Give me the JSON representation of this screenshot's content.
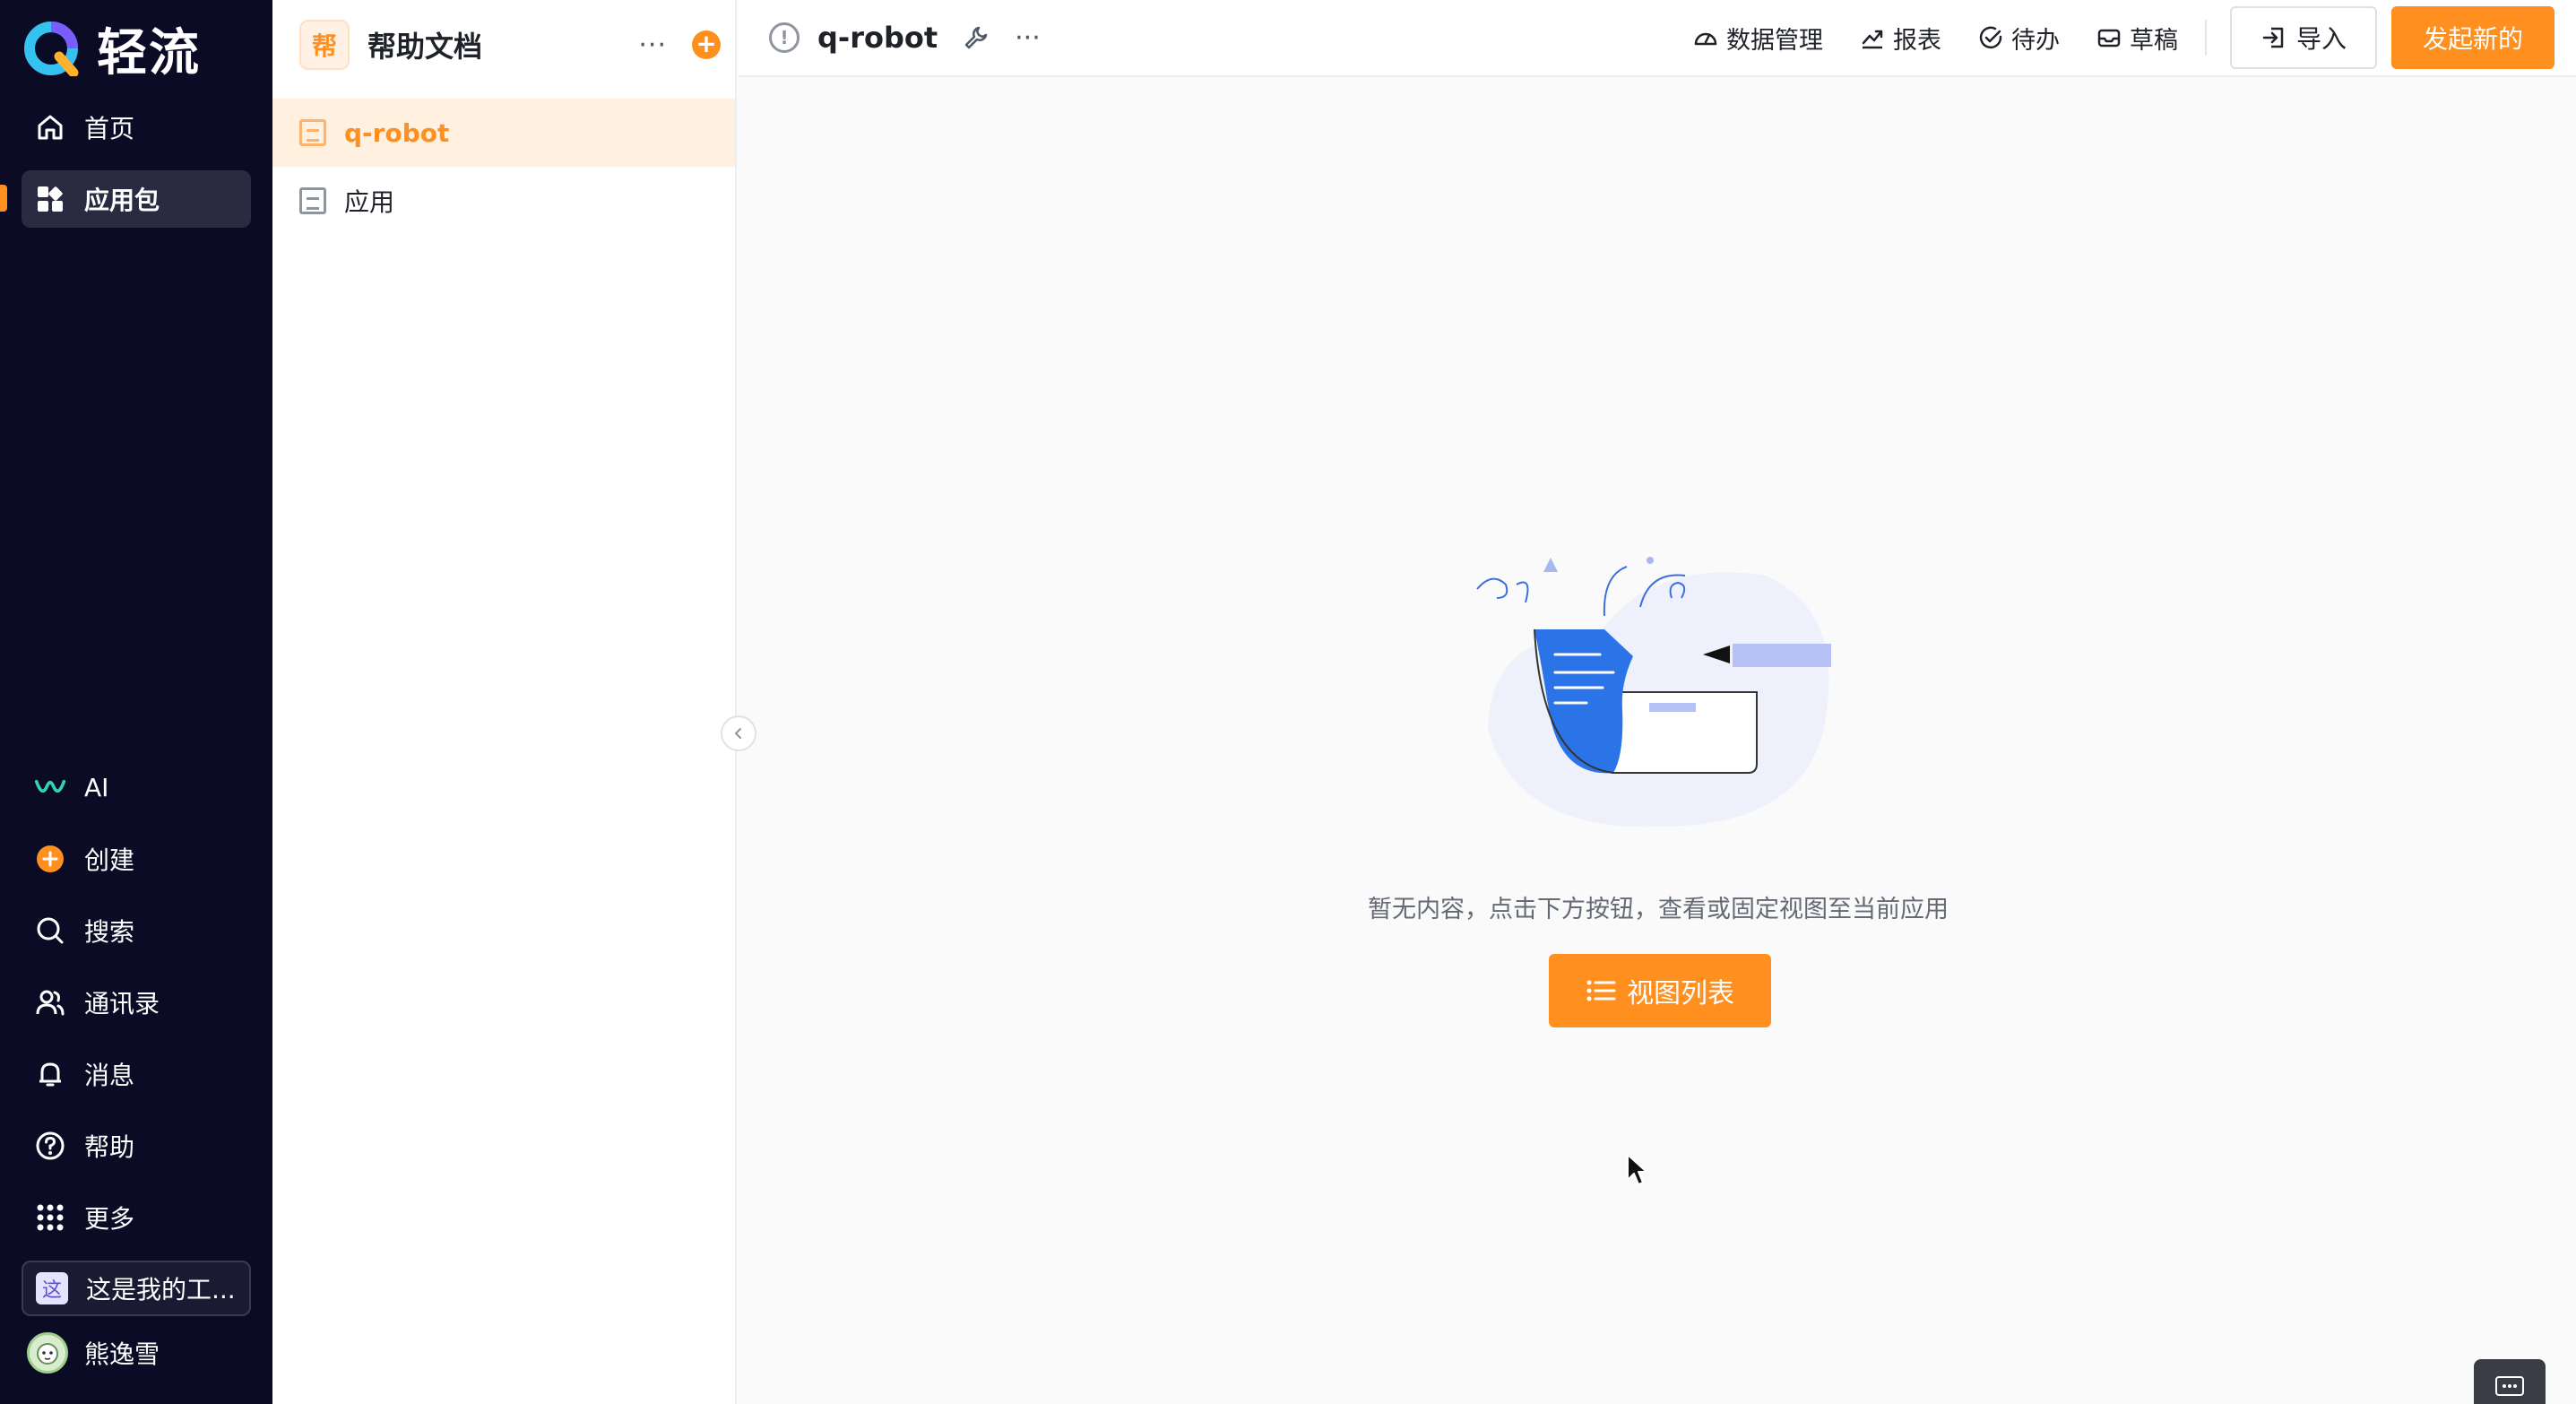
{
  "brand": {
    "name": "轻流"
  },
  "nav": {
    "top_items": [
      {
        "label": "首页",
        "icon": "home-icon"
      },
      {
        "label": "应用包",
        "icon": "apps-icon",
        "active": true
      }
    ],
    "bottom_items": [
      {
        "label": "AI",
        "icon": "ai-icon"
      },
      {
        "label": "创建",
        "icon": "create-plus-icon"
      },
      {
        "label": "搜索",
        "icon": "search-icon"
      },
      {
        "label": "通讯录",
        "icon": "contacts-icon"
      },
      {
        "label": "消息",
        "icon": "bell-icon"
      },
      {
        "label": "帮助",
        "icon": "help-icon"
      },
      {
        "label": "更多",
        "icon": "grid-icon"
      }
    ],
    "workspace": {
      "badge": "这",
      "label": "这是我的工..."
    },
    "user": {
      "name": "熊逸雪"
    }
  },
  "sidebar": {
    "app_badge": "帮",
    "title": "帮助文档",
    "more": "···",
    "add": "+",
    "items": [
      {
        "label": "q-robot",
        "selected": true
      },
      {
        "label": "应用",
        "selected": false
      }
    ]
  },
  "topbar": {
    "info": "!",
    "title": "q-robot",
    "more": "···",
    "links": [
      {
        "label": "数据管理",
        "icon": "dashboard-icon"
      },
      {
        "label": "报表",
        "icon": "chart-trend-icon"
      },
      {
        "label": "待办",
        "icon": "check-circle-icon"
      },
      {
        "label": "草稿",
        "icon": "inbox-icon"
      }
    ],
    "import_label": "导入",
    "start_label": "发起新的"
  },
  "empty_state": {
    "message": "暂无内容，点击下方按钮，查看或固定视图至当前应用",
    "button_label": "视图列表"
  },
  "colors": {
    "accent": "#ff8f1f",
    "nav_bg": "#0c0b26",
    "selected_bg": "#fff0e0"
  }
}
